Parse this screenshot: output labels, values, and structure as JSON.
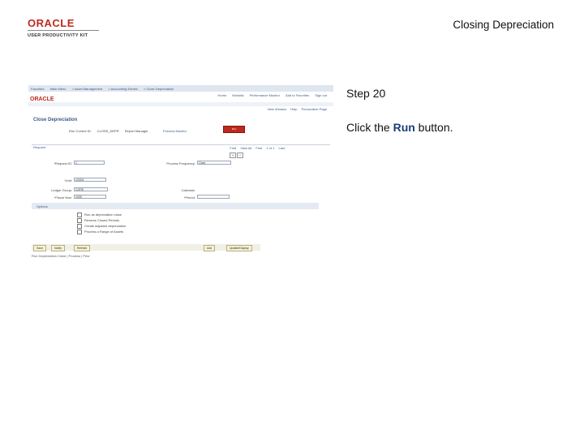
{
  "logo": {
    "brand": "ORACLE",
    "subtitle": "USER PRODUCTIVITY KIT"
  },
  "page_title": "Closing Depreciation",
  "step": {
    "label": "Step 20"
  },
  "instruction": {
    "prefix": "Click the ",
    "target": "Run",
    "suffix": " button."
  },
  "screenshot": {
    "nav_items": [
      "Favorites",
      "Main Menu",
      "> Asset Management",
      "> Accounting Entries",
      "> Close Depreciation"
    ],
    "brand": "ORACLE",
    "header_links": [
      "Home",
      "Worklist",
      "Performance Monitor",
      "Add to Favorites",
      "Sign out"
    ],
    "band_links": [
      "New Window",
      "Help",
      "Personalize Page"
    ],
    "page_title": "Close Depreciation",
    "run_control_label": "Run Control ID:",
    "run_control_value": "CLOSE_DEPR",
    "report_manager": "Report Manager",
    "process_monitor": "Process Monitor",
    "run_button": "Run",
    "section_label": "Request",
    "grid_links": [
      "Find",
      "View All",
      "First",
      "1 of 1",
      "Last"
    ],
    "fields": {
      "request_id_label": "*Request ID:",
      "request_id_value": "1",
      "process_frequency_label": "Process Frequency:",
      "process_frequency_value": "Once",
      "unit_label": "*Unit:",
      "unit_value": "US001",
      "fiscal_year_label": "*Fiscal Year:",
      "fiscal_year_value": "2005",
      "ledger_group_label": "Ledger Group:",
      "ledger_group_value": "CORE",
      "calendar_label": "Calendar:",
      "period_label": "*Period:"
    },
    "options_label": "Options",
    "options": [
      "Run as depreciation close",
      "Reverse Closed Periods",
      "Create adjusted depreciation",
      "Process a Range of Assets"
    ],
    "buttons": [
      "Save",
      "Notify",
      "Refresh",
      "Add",
      "Update/Display"
    ],
    "footer": "Run Depreciation Close | Process | Prior"
  }
}
